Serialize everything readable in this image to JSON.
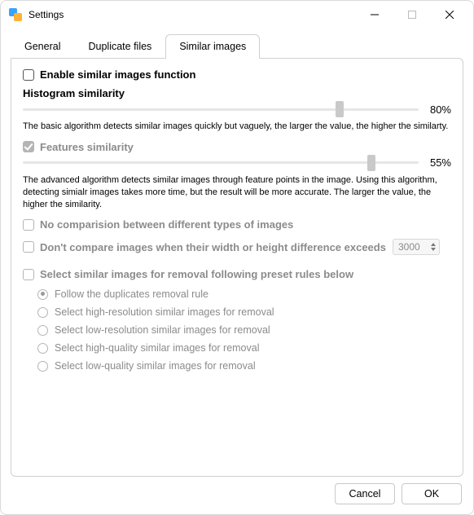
{
  "window": {
    "title": "Settings"
  },
  "tabs": {
    "general": "General",
    "duplicate_files": "Duplicate files",
    "similar_images": "Similar images",
    "active": "similar_images"
  },
  "enable": {
    "label": "Enable similar images function",
    "checked": false
  },
  "histogram": {
    "title": "Histogram similarity",
    "value_pct": 80,
    "value_text": "80%",
    "desc": "The basic algorithm detects similar images quickly but vaguely, the larger the value, the higher the similarty."
  },
  "features": {
    "title": "Features similarity",
    "checked": true,
    "enabled": false,
    "value_pct": 88,
    "value_text": "55%",
    "desc": "The advanced algorithm detects similar images through feature points in the image. Using this algorithm, detecting simialr images takes more time, but the result will be more accurate. The larger the value, the higher the similarity."
  },
  "no_compare_types": {
    "label": "No comparision between different types of images",
    "checked": false,
    "enabled": false
  },
  "dimension_diff": {
    "label": "Don't compare images when their width or height difference exceeds",
    "value": "3000",
    "checked": false,
    "enabled": false
  },
  "preset_rules": {
    "label": "Select similar images for removal following preset rules below",
    "checked": false,
    "enabled": false,
    "selected": 0,
    "options": [
      "Follow the duplicates removal rule",
      "Select high-resolution similar images for removal",
      "Select low-resolution similar images for removal",
      "Select high-quality similar images for removal",
      "Select low-quality similar images for removal"
    ]
  },
  "footer": {
    "cancel": "Cancel",
    "ok": "OK"
  }
}
